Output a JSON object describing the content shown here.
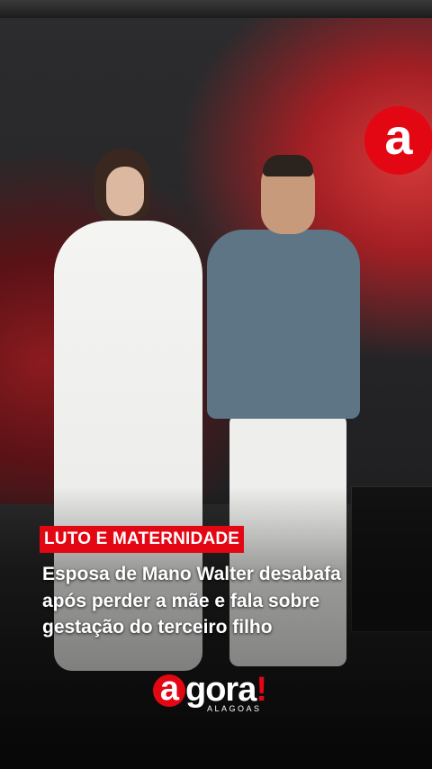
{
  "logo_badge": {
    "letter": "a"
  },
  "category_tag": "LUTO E MATERNIDADE",
  "headline": {
    "line1": "Esposa de Mano Walter desabafa",
    "line2": "após perder a mãe e fala sobre",
    "line3": "gestação do terceiro filho"
  },
  "brand": {
    "first_letter": "a",
    "rest": "gora",
    "bang": "!",
    "sub": "ALAGOAS"
  },
  "colors": {
    "accent": "#e30613",
    "text": "#ffffff"
  }
}
